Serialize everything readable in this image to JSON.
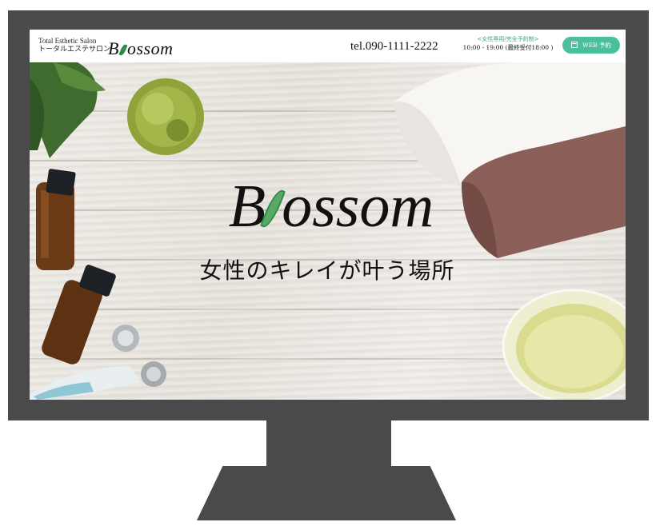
{
  "header": {
    "brand_en": "Total Esthetic Salon",
    "brand_jp": "トータルエステサロン",
    "logo_prefix": "B",
    "logo_suffix": "ossom",
    "tel": "tel.090-1111-2222",
    "hours_note": "<女性専用/完全予約制>",
    "hours": "10:00 - 19:00 (最終受付18:00 )",
    "web_button": "WEB 予約"
  },
  "hero": {
    "title_prefix": "B",
    "title_suffix": "ossom",
    "tagline": "女性のキレイが叶う場所"
  },
  "colors": {
    "accent": "#4bbf9b",
    "leaf": "#2e8c48",
    "bezel": "#4a4a4a"
  }
}
